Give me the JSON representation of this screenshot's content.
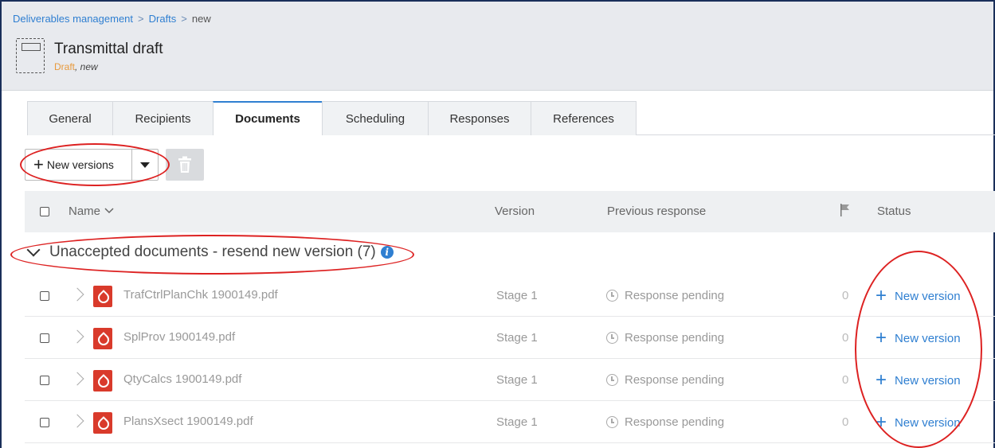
{
  "breadcrumb": {
    "items": [
      "Deliverables management",
      "Drafts",
      "new"
    ],
    "separator": ">"
  },
  "header": {
    "title": "Transmittal draft",
    "status": "Draft",
    "status_suffix": ", new"
  },
  "tabs": [
    {
      "label": "General",
      "active": false
    },
    {
      "label": "Recipients",
      "active": false
    },
    {
      "label": "Documents",
      "active": true
    },
    {
      "label": "Scheduling",
      "active": false
    },
    {
      "label": "Responses",
      "active": false
    },
    {
      "label": "References",
      "active": false
    }
  ],
  "toolbar": {
    "new_versions_label": "New versions"
  },
  "table": {
    "columns": {
      "name": "Name",
      "version": "Version",
      "previous_response": "Previous response",
      "status": "Status"
    }
  },
  "group": {
    "label": "Unaccepted documents - resend new version (7)",
    "info_icon": "i"
  },
  "rows": [
    {
      "name": "TrafCtrlPlanChk 1900149.pdf",
      "version": "Stage 1",
      "response": "Response pending",
      "count": "0",
      "action": "New version"
    },
    {
      "name": "SplProv 1900149.pdf",
      "version": "Stage 1",
      "response": "Response pending",
      "count": "0",
      "action": "New version"
    },
    {
      "name": "QtyCalcs 1900149.pdf",
      "version": "Stage 1",
      "response": "Response pending",
      "count": "0",
      "action": "New version"
    },
    {
      "name": "PlansXsect 1900149.pdf",
      "version": "Stage 1",
      "response": "Response pending",
      "count": "0",
      "action": "New version"
    }
  ],
  "icons": {
    "document": "document-icon",
    "add": "plus-icon",
    "dropdown": "caret-down-icon",
    "delete": "trash-icon",
    "sort": "chevron-down-icon",
    "flag": "flag-icon",
    "file": "pdf-icon",
    "pending": "clock-icon",
    "info": "info-icon"
  },
  "colors": {
    "link": "#2f7fd1",
    "draft": "#e89a3c",
    "pdf": "#d93a2b",
    "annotation": "#dd2222",
    "header_bg": "#e8eaee"
  }
}
